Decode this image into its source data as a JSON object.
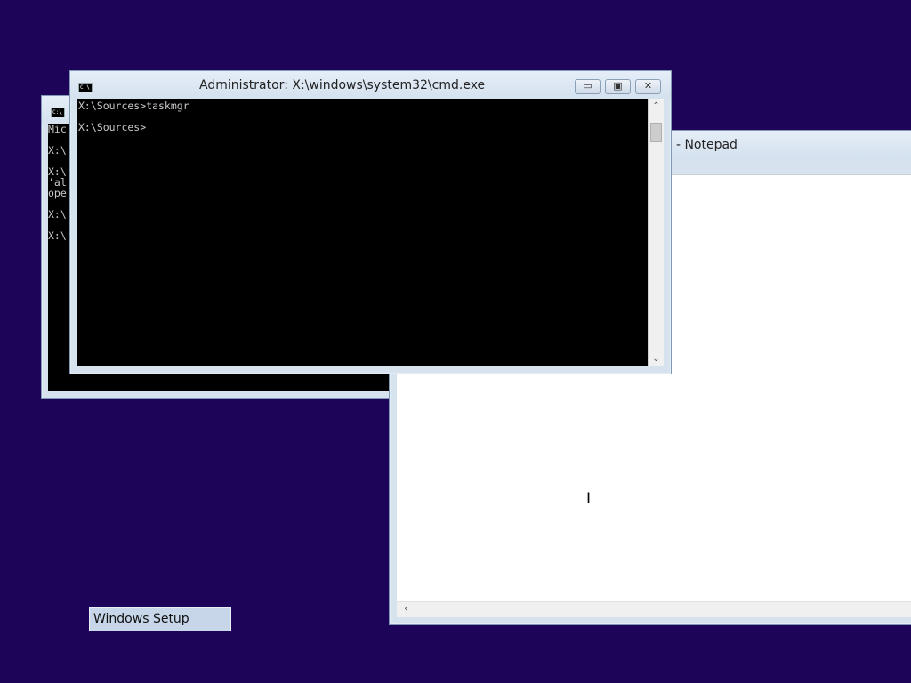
{
  "cmd_back": {
    "icon_text": "C:\\",
    "lines": [
      "Mic",
      "",
      "X:\\",
      "",
      "X:\\",
      "'al",
      "ope",
      "",
      "X:\\",
      "",
      "X:\\"
    ]
  },
  "cmd_front": {
    "title": "Administrator: X:\\windows\\system32\\cmd.exe",
    "icon_text": "C:\\",
    "lines": [
      "X:\\Sources>taskmgr",
      "",
      "X:\\Sources>"
    ],
    "buttons": {
      "minimize": "▭",
      "restore": "▣",
      "close": "✕"
    }
  },
  "notepad": {
    "title": "ed - Notepad",
    "scroll_left_arrow": "‹"
  },
  "scroll": {
    "up_arrow": "⌃",
    "down_arrow": "⌄"
  },
  "taskbar": {
    "setup_label": "Windows Setup"
  },
  "cursor": {
    "glyph": "I"
  }
}
